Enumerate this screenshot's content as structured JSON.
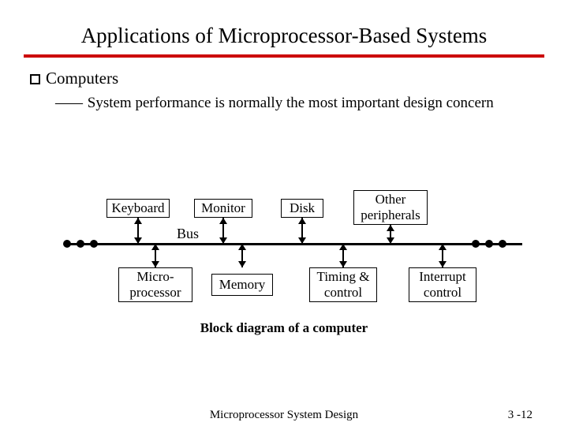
{
  "title": "Applications of Microprocessor-Based Systems",
  "bullet1": "Computers",
  "bullet2": "System performance is normally the most important design concern",
  "diagram": {
    "bus_label": "Bus",
    "top_boxes": {
      "keyboard": "Keyboard",
      "monitor": "Monitor",
      "disk": "Disk",
      "other": "Other\nperipherals"
    },
    "bottom_boxes": {
      "micro": "Micro-\nprocessor",
      "memory": "Memory",
      "timing": "Timing &\ncontrol",
      "interrupt": "Interrupt\ncontrol"
    },
    "caption": "Block diagram of a computer"
  },
  "footer": {
    "center": "Microprocessor System Design",
    "right": "3 -12"
  }
}
